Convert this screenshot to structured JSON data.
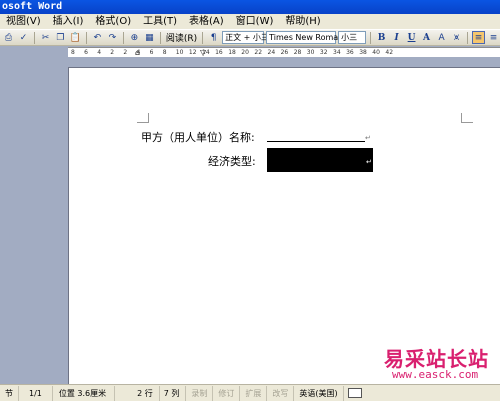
{
  "window": {
    "title": "osoft Word"
  },
  "menu": [
    "视图(V)",
    "插入(I)",
    "格式(O)",
    "工具(T)",
    "表格(A)",
    "窗口(W)",
    "帮助(H)"
  ],
  "toolbar": {
    "read_label": "阅读(R)",
    "style_value": "正文 + 小三",
    "font_value": "Times New Roman",
    "size_value": "小三",
    "bold": "B",
    "italic": "I",
    "underline": "U",
    "font_color": "A"
  },
  "ruler": {
    "numbers": [
      "8",
      "6",
      "4",
      "2",
      "2",
      "4",
      "6",
      "8",
      "10",
      "12",
      "14",
      "16",
      "18",
      "20",
      "22",
      "24",
      "26",
      "28",
      "30",
      "32",
      "34",
      "36",
      "38",
      "40",
      "42"
    ]
  },
  "document": {
    "line1_label": "甲方（用人单位）名称:",
    "line2_label": "经济类型:"
  },
  "status": {
    "section": "节",
    "page": "1/1",
    "position": "位置 3.6厘米",
    "line": "2 行",
    "column": "7 列",
    "rec": "录制",
    "trk": "修订",
    "ext": "扩展",
    "ovr": "改写",
    "language": "英语(美国)"
  },
  "watermark": {
    "text": "易采站长站",
    "url": "www.easck.com"
  },
  "colors": {
    "titlebar": "#0a55e3",
    "chrome": "#ece9d8",
    "workspace": "#a2acc2",
    "watermark": "#d9206f"
  }
}
